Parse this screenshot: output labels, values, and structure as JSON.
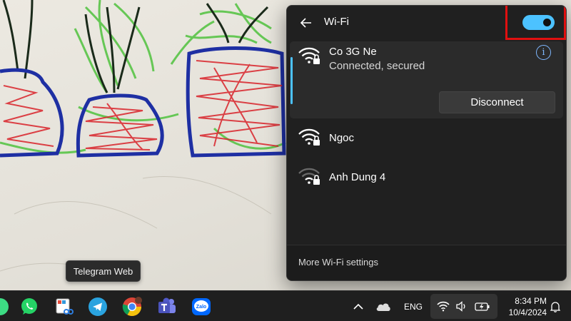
{
  "flyout": {
    "title": "Wi-Fi",
    "toggle_on": true,
    "accent_color": "#4cc2ff",
    "highlight_color": "#e01010",
    "connected_network": {
      "name": "Co 3G Ne",
      "status": "Connected, secured",
      "disconnect_label": "Disconnect",
      "info_label": "i"
    },
    "networks": [
      {
        "name": "Ngoc",
        "signal": "strong"
      },
      {
        "name": "Anh Dung 4",
        "signal": "weak"
      }
    ],
    "footer_label": "More Wi-Fi settings"
  },
  "tooltip": {
    "text": "Telegram Web"
  },
  "taskbar": {
    "apps": [
      "android-icon",
      "whatsapp-icon",
      "snipping-tool-icon",
      "telegram-icon",
      "chrome-icon",
      "teams-icon",
      "zalo-icon"
    ],
    "zalo_label": "Zalo",
    "language": "ENG",
    "time": "8:34 PM",
    "date": "10/4/2024"
  }
}
